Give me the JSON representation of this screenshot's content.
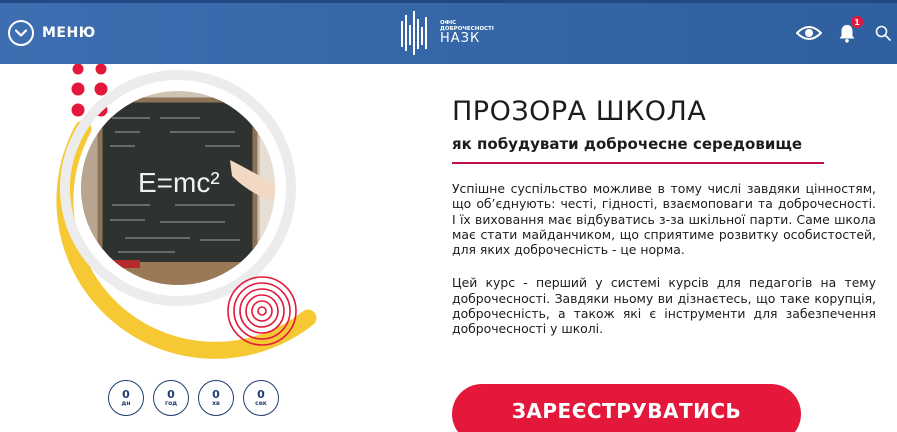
{
  "header": {
    "menu_label": "МЕНЮ",
    "logo_small_line1": "ОФІС",
    "logo_small_line2": "ДОБРОЧЕСНОСТІ",
    "logo_big": "НАЗК",
    "notification_count": "1",
    "icons": [
      "chevron-down-icon",
      "eye-icon",
      "bell-icon",
      "search-icon"
    ]
  },
  "course": {
    "title": "ПРОЗОРА ШКОЛА",
    "subtitle": "як побудувати доброчесне середовище",
    "paragraph1": "Успішне суспільство можливе в тому числі завдяки цінностям, що об’єднують: честі, гідності, взаємоповаги та доброчесності. І їх виховання має відбуватись з-за шкільної парти. Саме школа має стати майданчиком, що сприятиме розвитку особистостей, для яких доброчесність - це норма.",
    "paragraph2": "Цей курс - перший у системі курсів для педагогів на тему доброчесності. Завдяки ньому ви дізнаєтесь, що таке корупція, доброчесність, а також які є інструменти для забезпечення доброчесності у школі.",
    "register_button": "ЗАРЕЄСТРУВАТИСЬ"
  },
  "countdown": [
    {
      "value": "0",
      "unit": "дн"
    },
    {
      "value": "0",
      "unit": "год"
    },
    {
      "value": "0",
      "unit": "хв"
    },
    {
      "value": "0",
      "unit": "сек"
    }
  ],
  "artwork": {
    "chalkboard_text": "E=mc²"
  },
  "colors": {
    "header_blue": "#3c6eb1",
    "accent_red": "#e3183b",
    "accent_yellow": "#f6c934",
    "counter_navy": "#1f3e72"
  }
}
